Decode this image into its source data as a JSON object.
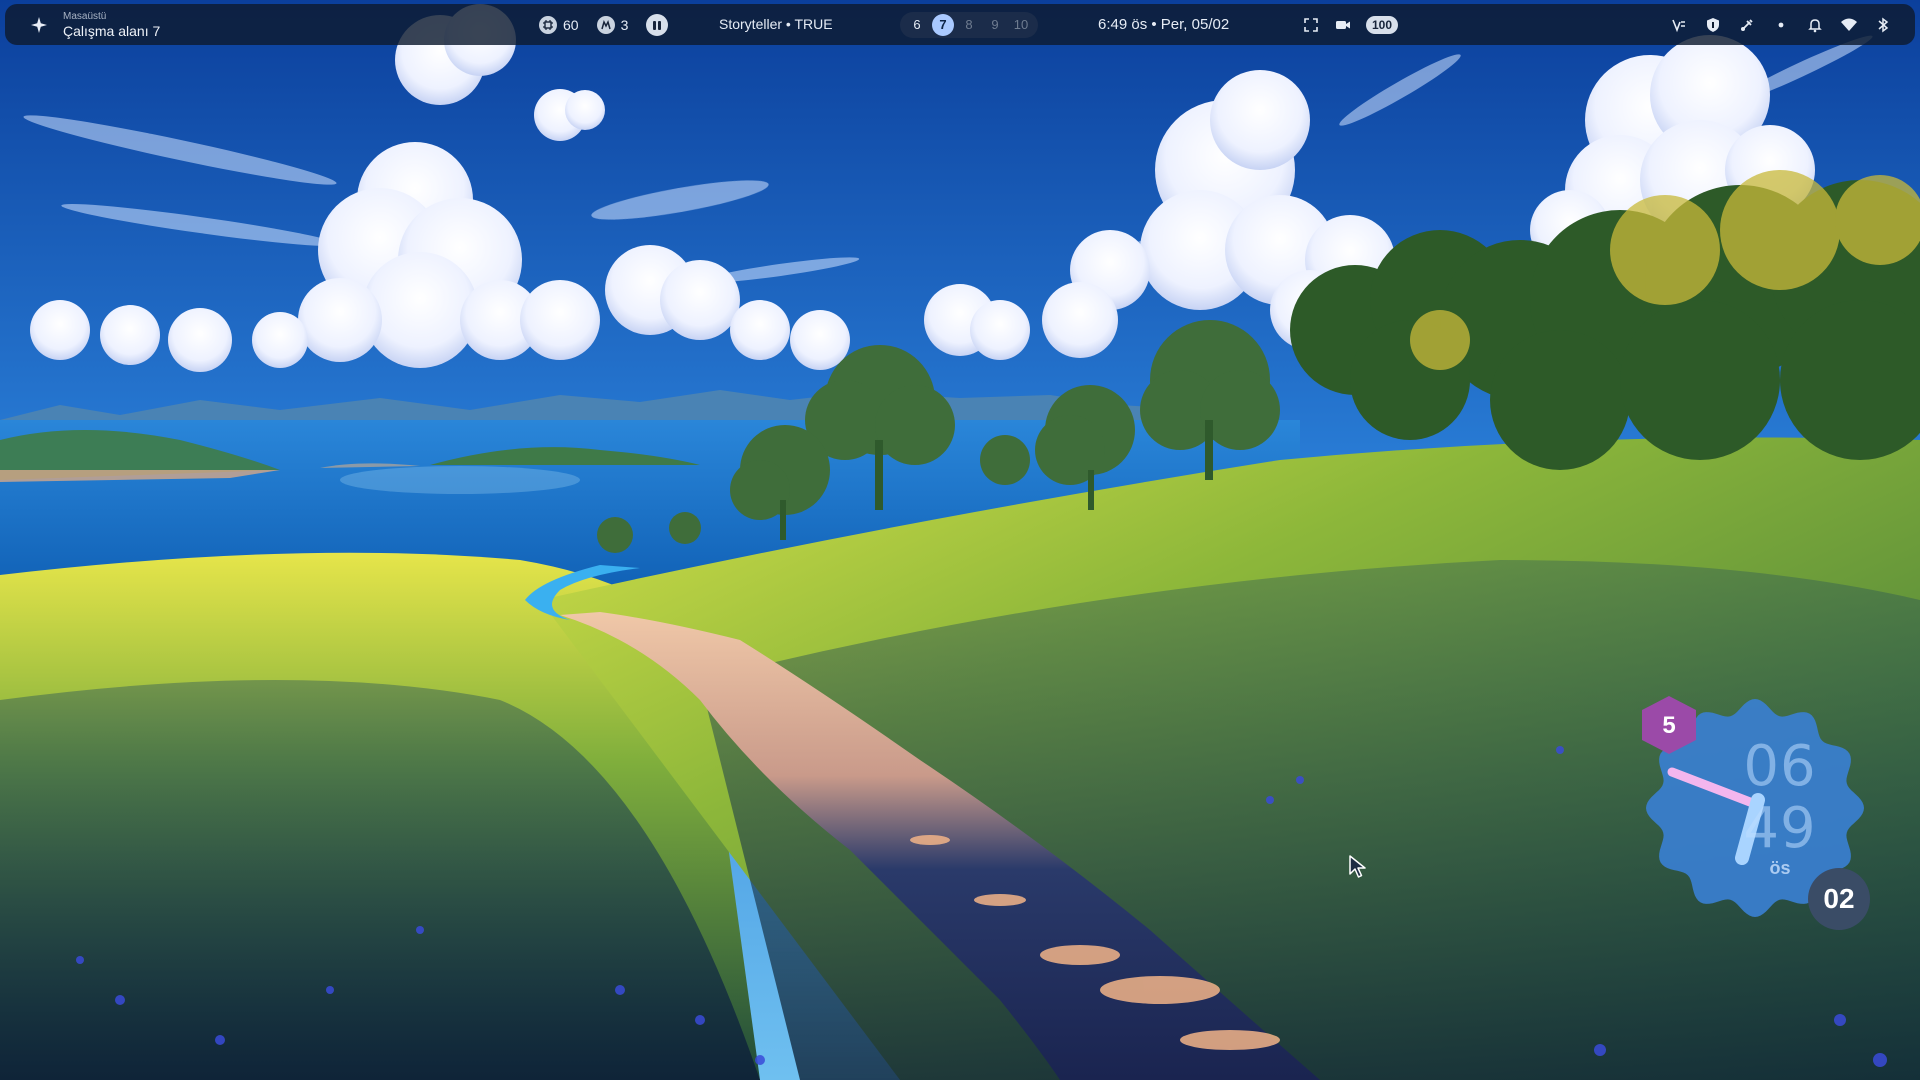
{
  "topbar": {
    "workspace_caption": "Masaüstü",
    "workspace_title": "Çalışma alanı 7",
    "workspace_icon": "sparkle-icon",
    "resources": [
      {
        "icon": "cpu-icon",
        "value": "60"
      },
      {
        "icon": "memory-icon",
        "value": "3"
      }
    ],
    "media_title": "Storyteller • TRUE",
    "workspaces": [
      {
        "label": "6",
        "state": "occupied"
      },
      {
        "label": "7",
        "state": "active"
      },
      {
        "label": "8",
        "state": "empty"
      },
      {
        "label": "9",
        "state": "empty"
      },
      {
        "label": "10",
        "state": "empty"
      }
    ],
    "clock": "6:49 ös • Per, 05/02",
    "battery": "100",
    "tray_icons": [
      "keyboard-icon",
      "shield-icon",
      "usb-icon",
      "dot-icon",
      "bell-icon",
      "wifi-icon",
      "bluetooth-icon"
    ]
  },
  "clock_widget": {
    "hour": "06",
    "minute": "49",
    "ampm": "ös",
    "seconds": "02",
    "badge": "5"
  },
  "colors": {
    "bar_background": "#0e1b30",
    "workspace_active": "#a9c9ff",
    "widget_face": "#3a7fd0",
    "widget_hand": "#f3b6ee",
    "badge": "#9b4aa8",
    "seconds_badge": "#3a4c66"
  }
}
